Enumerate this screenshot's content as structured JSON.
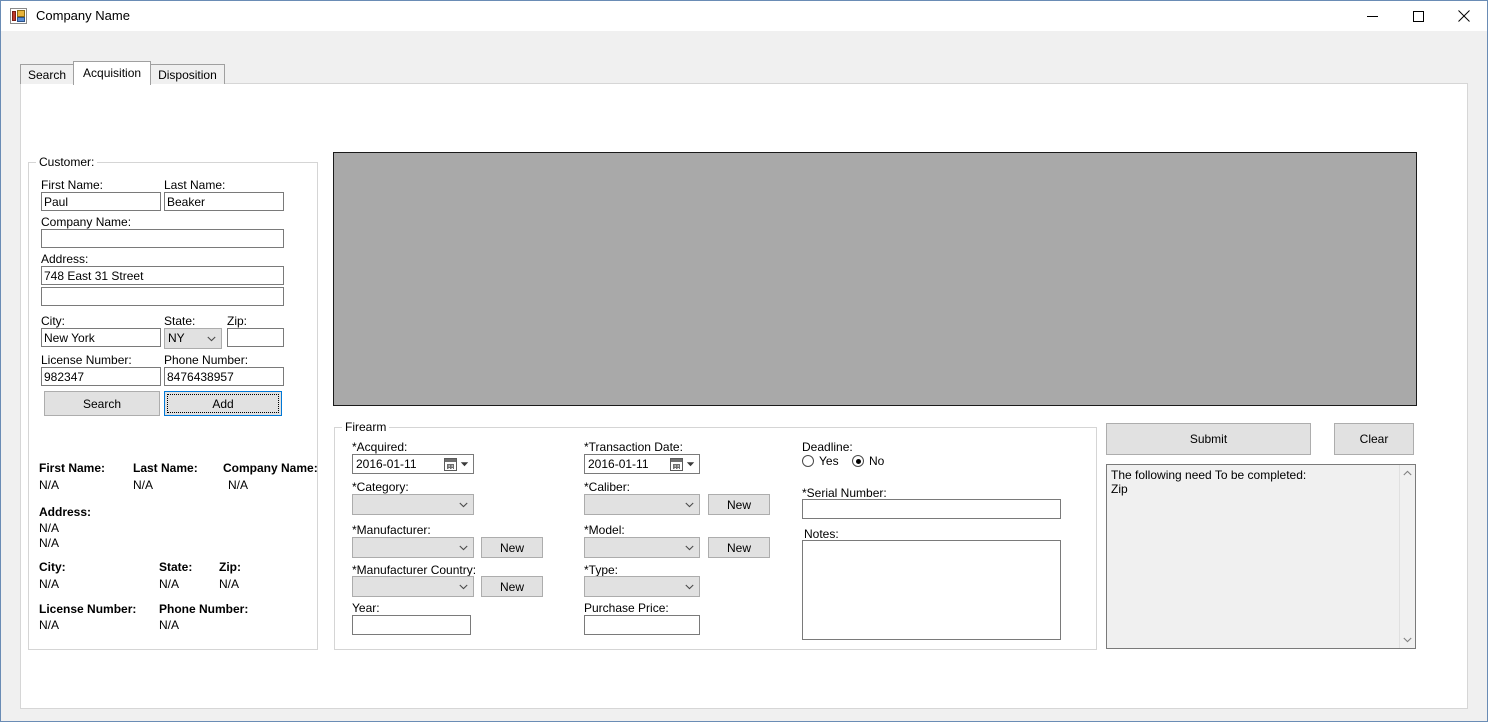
{
  "window": {
    "title": "Company Name",
    "icon": "winforms-app-icon",
    "controls": {
      "minimize": "minimize-icon",
      "maximize": "maximize-icon",
      "close": "close-icon"
    }
  },
  "tabs": [
    {
      "label": "Search",
      "selected": false
    },
    {
      "label": "Acquisition",
      "selected": true
    },
    {
      "label": "Disposition",
      "selected": false
    }
  ],
  "customer_group": {
    "title": "Customer:",
    "first_name_label": "First Name:",
    "first_name_value": "Paul",
    "last_name_label": "Last Name:",
    "last_name_value": "Beaker",
    "company_name_label": "Company Name:",
    "company_name_value": "",
    "address_label": "Address:",
    "address_line1_value": "748 East 31 Street",
    "address_line2_value": "",
    "city_label": "City:",
    "city_value": "New York",
    "state_label": "State:",
    "state_value": "NY",
    "zip_label": "Zip:",
    "zip_value": "",
    "license_number_label": "License Number:",
    "license_number_value": "982347",
    "phone_number_label": "Phone Number:",
    "phone_number_value": "8476438957",
    "search_button": "Search",
    "add_button": "Add"
  },
  "customer_summary": {
    "first_name_label": "First Name:",
    "first_name_value": "N/A",
    "last_name_label": "Last Name:",
    "last_name_value": "N/A",
    "company_name_label": "Company Name:",
    "company_name_value": "N/A",
    "address_label": "Address:",
    "address_line1_value": "N/A",
    "address_line2_value": "N/A",
    "city_label": "City:",
    "city_value": "N/A",
    "state_label": "State:",
    "state_value": "N/A",
    "zip_label": "Zip:",
    "zip_value": "N/A",
    "license_number_label": "License Number:",
    "license_number_value": "N/A",
    "phone_number_label": "Phone Number:",
    "phone_number_value": "N/A"
  },
  "firearm_group": {
    "title": "Firearm",
    "acquired_label": "*Acquired:",
    "acquired_value": "2016-01-11",
    "category_label": "*Category:",
    "category_value": "",
    "manufacturer_label": "*Manufacturer:",
    "manufacturer_value": "",
    "manufacturer_new_button": "New",
    "manufacturer_country_label": "*Manufacturer Country:",
    "manufacturer_country_value": "",
    "manufacturer_country_new_button": "New",
    "year_label": "Year:",
    "year_value": "",
    "transaction_date_label": "*Transaction Date:",
    "transaction_date_value": "2016-01-11",
    "caliber_label": "*Caliber:",
    "caliber_value": "",
    "caliber_new_button": "New",
    "model_label": "*Model:",
    "model_value": "",
    "model_new_button": "New",
    "type_label": "*Type:",
    "type_value": "",
    "purchase_price_label": "Purchase Price:",
    "purchase_price_value": "",
    "deadline_label": "Deadline:",
    "deadline_yes_label": "Yes",
    "deadline_no_label": "No",
    "deadline_selected": "No",
    "serial_number_label": "*Serial Number:",
    "serial_number_value": "",
    "notes_label": "Notes:",
    "notes_value": ""
  },
  "actions": {
    "submit_button": "Submit",
    "clear_button": "Clear"
  },
  "messages": {
    "text": "The following need To be completed:\nZip",
    "scroll_up_icon": "chevron-up-icon",
    "scroll_down_icon": "chevron-down-icon"
  },
  "colors": {
    "window_border": "#6a8cb5",
    "client_background": "#f0f0f0",
    "tab_page_background": "#ffffff",
    "image_placeholder": "#a9a9a9",
    "button_face": "#e1e1e1",
    "focus_accent": "#0078d7",
    "textbox_border": "#7a7a7a"
  }
}
